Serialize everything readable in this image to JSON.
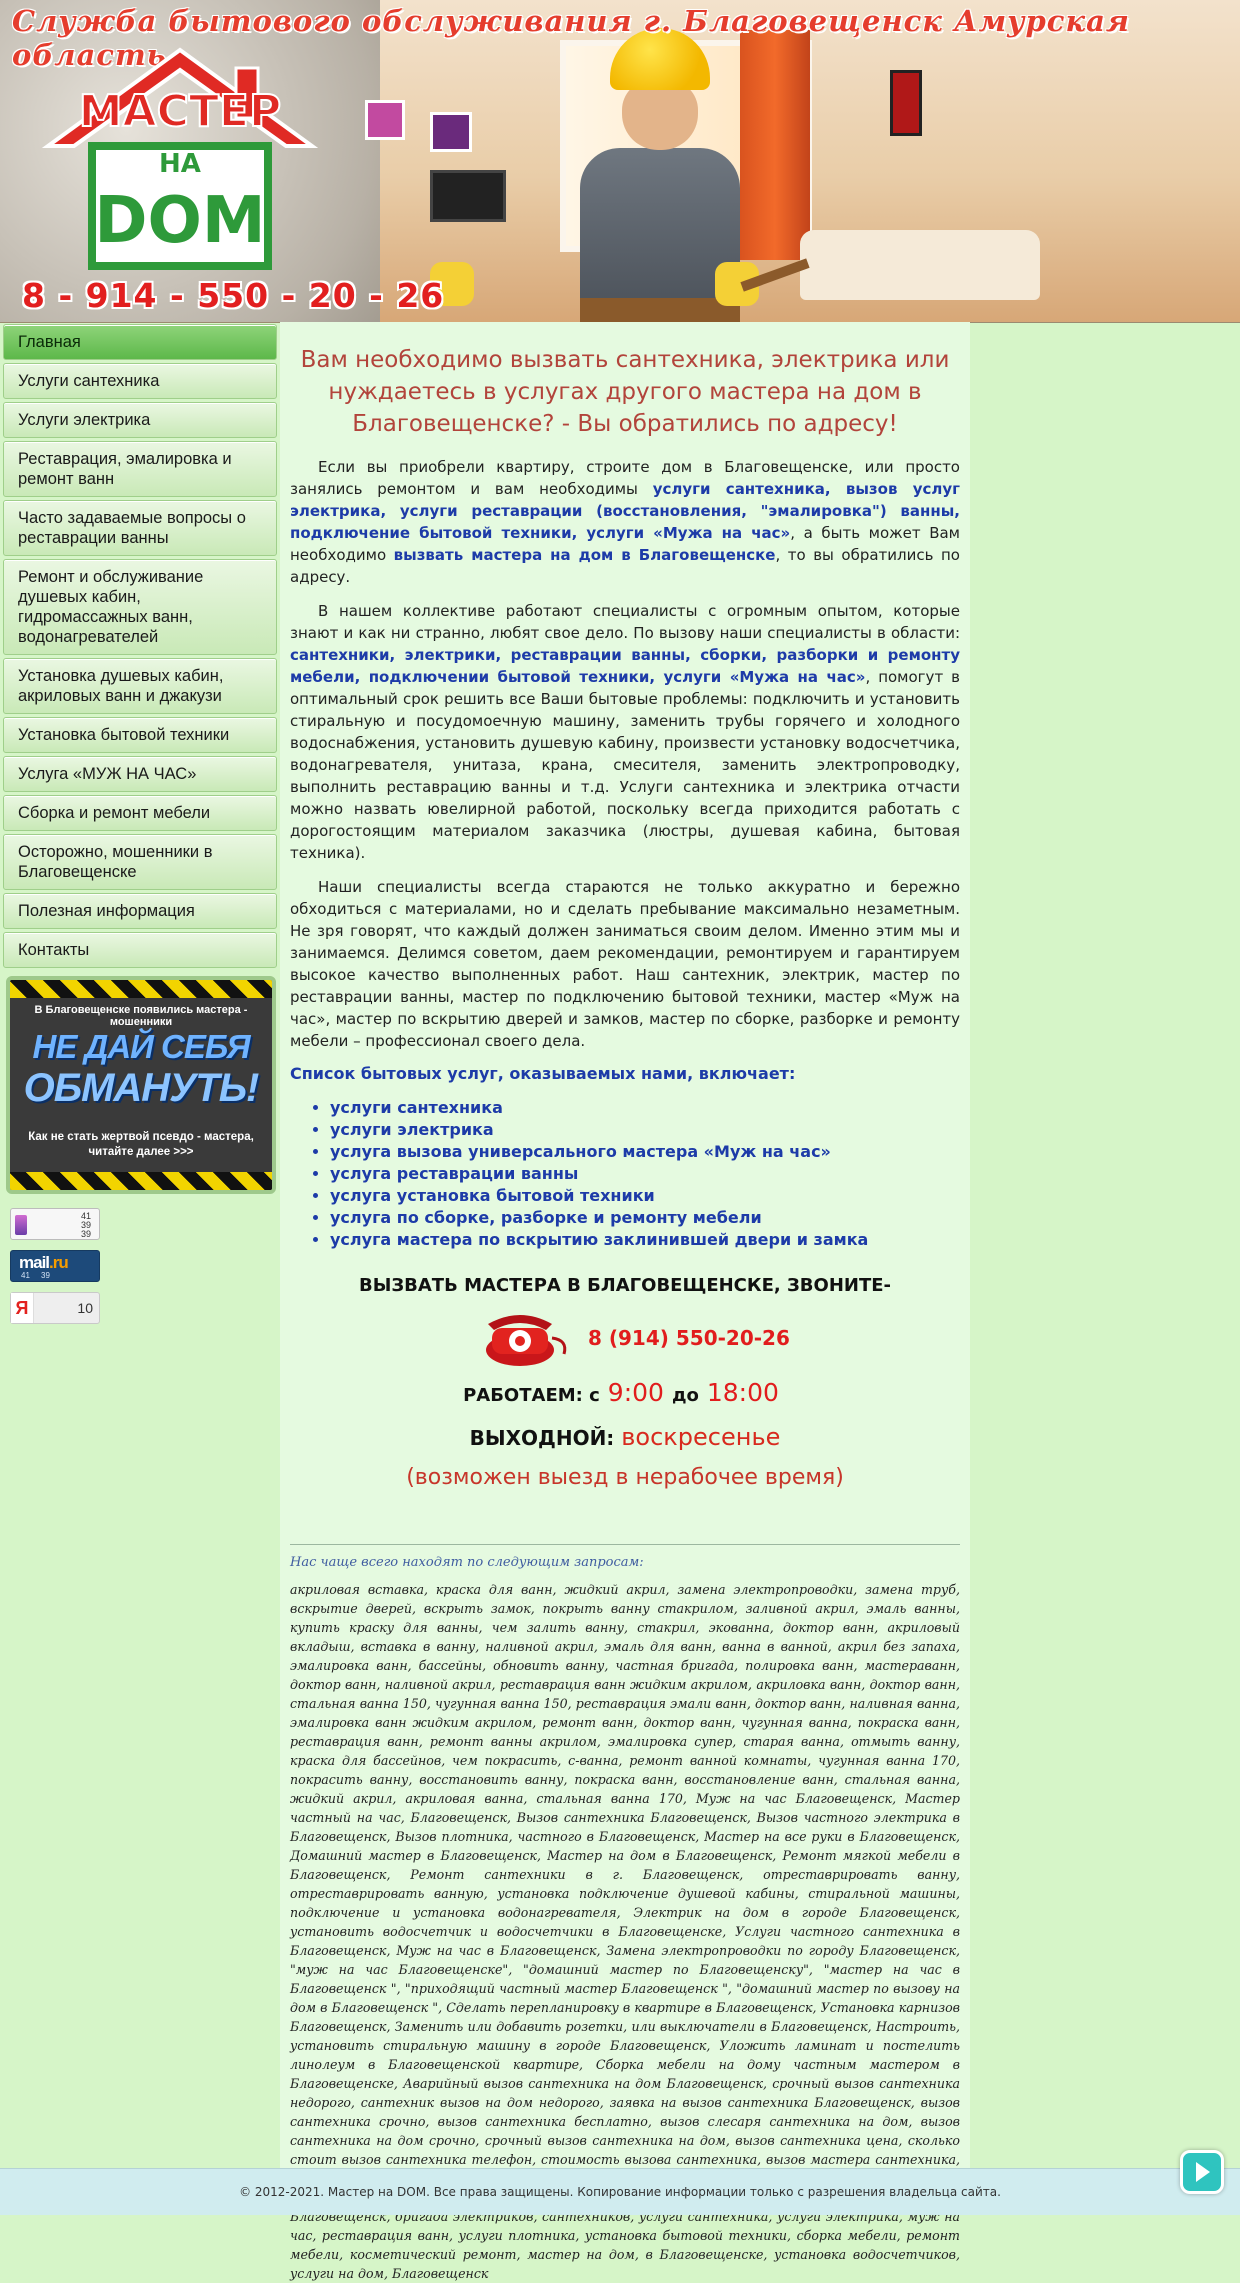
{
  "header": {
    "title": "Служба бытового обслуживания г. Благовещенск Амурская область",
    "logo_top": "МАСТЕР",
    "logo_mid": "НА",
    "logo_bottom": "DOM",
    "phone": "8 - 914 - 550 - 20 - 26"
  },
  "sidebar": {
    "items": [
      {
        "label": "Главная"
      },
      {
        "label": "Услуги сантехника"
      },
      {
        "label": "Услуги электрика"
      },
      {
        "label": "Реставрация, эмалировка и ремонт ванн"
      },
      {
        "label": "Часто задаваемые вопросы о реставрации ванны"
      },
      {
        "label": "Ремонт и обслуживание душевых кабин, гидромассажных ванн, водонагревателей"
      },
      {
        "label": "Установка душевых кабин, акриловых ванн и джакузи"
      },
      {
        "label": "Установка бытовой техники"
      },
      {
        "label": "Услуга «МУЖ НА ЧАС»"
      },
      {
        "label": "Сборка и ремонт мебели"
      },
      {
        "label": "Осторожно, мошенники в Благовещенске"
      },
      {
        "label": "Полезная информация"
      },
      {
        "label": "Контакты"
      }
    ],
    "banner": {
      "top_text": "В Благовещенске появились мастера - мошенники",
      "line1": "НЕ ДАЙ СЕБЯ",
      "line2": "ОБМАНУТЬ!",
      "sub": "Как не стать жертвой псевдо - мастера, читайте далее >>>"
    },
    "counters": {
      "liveinternet": {
        "a": "41",
        "b": "39",
        "c": "39"
      },
      "mailru": {
        "logo": "mail",
        "dot": ".ru",
        "a": "41",
        "b": "39"
      },
      "yandex": {
        "logo": "Я",
        "value": "10"
      }
    }
  },
  "main": {
    "heading": "Вам необходимо вызвать сантехника, электрика или нуждаетесь в услугах другого мастера на дом в Благовещенске? - Вы  обратились по адресу!",
    "p1": {
      "t1": "Если вы приобрели квартиру, строите дом в Благовещенске, или просто занялись ремонтом и вам необходимы ",
      "b1": "услуги сантехника, вызов услуг электрика,  услуги реставрации (восстановления, \"эмалировка\") ванны, подключение бытовой техники,  услуги «Мужа на час»",
      "t2": ", а быть может Вам необходимо ",
      "b2": "вызвать мастера на дом в Благовещенске",
      "t3": ", то вы обратились по адресу."
    },
    "p2": {
      "t1": "В нашем коллективе работают специалисты с огромным опытом, которые знают и как ни странно, любят свое дело. По вызову наши специалисты в области: ",
      "b1": "сантехники, электрики, реставрации ванны, сборки, разборки и ремонту мебели, подключении бытовой техники,  услуги «Мужа на час»",
      "t2": ", помогут в оптимальный срок решить все Ваши бытовые проблемы: подключить и установить стиральную и посудомоечную машину, заменить трубы горячего и холодного водоснабжения, установить душевую кабину, произвести установку водосчетчика, водонагревателя, унитаза, крана, смесителя,  заменить электропроводку, выполнить реставрацию ванны и т.д.  Услуги сантехника и электрика отчасти можно назвать ювелирной работой, поскольку всегда приходится работать с дорогостоящим материалом заказчика (люстры, душевая кабина, бытовая техника)."
    },
    "p3": "Наши специалисты всегда стараются не только аккуратно и бережно обходиться с материалами, но и сделать пребывание максимально незаметным. Не зря говорят, что каждый должен заниматься своим делом. Именно этим мы и занимаемся. Делимся советом, даем рекомендации, ремонтируем и гарантируем высокое качество выполненных работ. Наш сантехник, электрик, мастер по реставрации ванны, мастер по подключению бытовой техники,  мастер «Муж на час», мастер по вскрытию дверей и замков, мастер по сборке, разборке и ремонту мебели – профессионал своего дела.",
    "list_title": "Список бытовых услуг, оказываемых нами, включает:",
    "services": [
      "услуги сантехника",
      "услуги электрика",
      "услуга вызова универсального мастера «Муж на час»",
      "услуга реставрации ванны",
      "услуга установка бытовой техники",
      "услуга по сборке, разборке и ремонту мебели",
      "услуга мастера по вскрытию заклинившей двери и замка"
    ],
    "call_title": "ВЫЗВАТЬ МАСТЕРА В БЛАГОВЕЩЕНСКЕ, ЗВОНИТЕ-",
    "phone": "8 (914) 550-20-26",
    "hours_label": "РАБОТАЕМ: с",
    "hours_from": "9:00",
    "hours_to_label": "до",
    "hours_to": "18:00",
    "day_off_label": "ВЫХОДНОЙ:",
    "day_off": "воскресенье",
    "note": "(возможен выезд в нерабочее время)",
    "keywords_title": "Нас чаще всего находят по следующим запросам:",
    "keywords": "акриловая вставка, краска для ванн, жидкий акрил, замена электропроводки, замена труб, вскрытие дверей, вскрыть замок, покрыть ванну стакрилом, заливной акрил, эмаль ванны, купить краску для ванны, чем залить ванну, стакрил, экованна, доктор ванн, акриловый вкладыш, вставка в ванну, наливной акрил, эмаль для ванн, ванна в ванной, акрил без запаха, эмалировка ванн, бассейны, обновить ванну, частная бригада, полировка ванн, мастераванн, доктор ванн, наливной акрил, реставрация ванн жидким акрилом, акриловка ванн, доктор ванн, стальная ванна 150, чугунная ванна 150, реставрация эмали ванн, доктор ванн, наливная ванна, эмалировка ванн жидким акрилом, ремонт ванн, доктор ванн, чугунная ванна, покраска ванн, реставрация ванн, ремонт ванны акрилом, эмалировка супер, старая ванна, отмыть ванну, краска для бассейнов, чем покрасить, с-ванна, ремонт ванной комнаты, чугунная ванна 170, покрасить ванну, восстановить ванну, покраска ванн, восстановление ванн, стальная ванна, жидкий акрил, акриловая ванна, стальная ванна 170, Муж на час Благовещенск,  Мастер частный на час, Благовещенск, Вызов сантехника Благовещенск, Вызов частного электрика в Благовещенск, Вызов плотника, частного в Благовещенск,  Мастер на все руки в Благовещенск, Домашний мастер в Благовещенск, Мастер на дом в Благовещенск, Ремонт мягкой мебели в Благовещенск, Ремонт сантехники в г. Благовещенск,   отреставрировать ванну, отреставрировать ванную, установка подключение душевой кабины, стиральной машины, подключение и установка водонагревателя, Электрик на дом в городе Благовещенск, установить водосчетчик и водосчетчики в Благовещенске, Услуги частного сантехника в Благовещенск, Муж на час в Благовещенск, Замена электропроводки по городу Благовещенск, \"муж на час Благовещенске\", \"домашний мастер по Благовещенску\", \"мастер на час в Благовещенск \", \"приходящий частный мастер Благовещенск \", \"домашний мастер по вызову на дом в Благовещенск \", Сделать перепланировку в квартире в Благовещенск, Установка карнизов Благовещенск, Заменить или добавить розетки, или выключатели в Благовещенск, Настроить, установить стиральную машину в городе Благовещенск, Уложить ламинат и постелить линолеум в Благовещенской квартире, Сборка мебели на дому частным мастером в Благовещенске, Аварийный вызов сантехника на дом Благовещенск, срочный вызов сантехника недорого, сантехник вызов на дом недорого, заявка на вызов сантехника Благовещенск, вызов сантехника срочно, вызов сантехника бесплатно, вызов слесаря сантехника на дом, вызов сантехника на дом срочно, срочный вызов сантехника на дом, вызов сантехника цена, сколько стоит вызов сантехника телефон, стоимость вызова сантехника, вызов мастера сантехника, вызов сантехника на дом цена, слесарь сантехник, услуги сантехника, вызвать сантехника на дом, установка сантехники, сантехник электрик, услуги электрика, вызов электрика в Благовещенск, бригада электриков, сантехников, услуги сантехника, услуги электрика, муж на час, реставрация ванн, услуги плотника, установка бытовой техники, сборка мебели, ремонт мебели, косметический ремонт, мастер на дом, в Благовещенске, установка водосчетчиков, услуги на дом, Благовещенск"
  },
  "footer": {
    "text": "© 2012-2021. Мастер на DOM. Все права защищены. Копирование информации только с разрешения владельца сайта."
  },
  "colors": {
    "background": "#d6f5c8",
    "content_bg": "#e5fae0",
    "heading": "#b2443b",
    "link": "#1d3ba8",
    "accent_red": "#e11d1d",
    "menu_active": "#5db84a"
  },
  "icons": {
    "phone": "red-telephone-icon",
    "scroll": "play-chat-icon"
  }
}
